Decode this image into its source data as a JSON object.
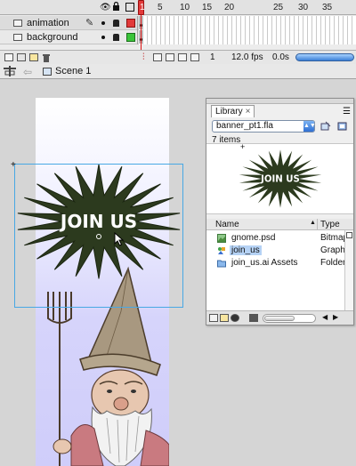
{
  "timeline": {
    "frame_numbers": [
      "1",
      "5",
      "10",
      "15",
      "20",
      "25",
      "30",
      "35"
    ],
    "layers": [
      {
        "name": "animation"
      },
      {
        "name": "background"
      }
    ],
    "footer": {
      "current_frame": "1",
      "frame_rate": "12.0 fps",
      "elapsed_time": "0.0s"
    },
    "colors": {
      "playhead": "#e23a3a",
      "layer_outline_animation": "#e23a3a",
      "layer_outline_background": "#3ac43a"
    }
  },
  "editbar": {
    "scene": "Scene 1"
  },
  "stage": {
    "symbol_text": "JOIN US",
    "colors": {
      "starburst": "#2c3a1e",
      "text": "#ffffff",
      "bounding_box": "#48a8e4"
    }
  },
  "library": {
    "tab_label": "Library",
    "tab_close": "×",
    "document": "banner_pt1.fla",
    "item_count": "7 items",
    "preview_text": "JOIN US",
    "columns": {
      "name": "Name",
      "type": "Type"
    },
    "items": [
      {
        "name": "gnome.psd",
        "type": "Bitmap",
        "icon": "bitmap-icon"
      },
      {
        "name": "join_us",
        "type": "Graphic",
        "icon": "graphic-symbol-icon",
        "selected": true
      },
      {
        "name": "join_us.ai Assets",
        "type": "Folder",
        "icon": "folder-icon"
      }
    ]
  }
}
